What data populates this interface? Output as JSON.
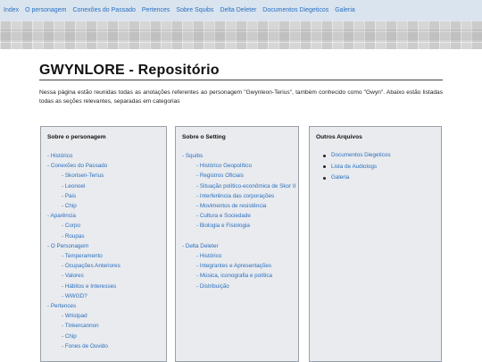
{
  "nav": [
    "Index",
    "O personagem",
    "Conexões do Passado",
    "Pertences",
    "Sobre Squibs",
    "Delta Deleter",
    "Documentos Diegeticos",
    "Galeria"
  ],
  "page": {
    "title": "GWYNLORE - Repositório",
    "intro": "Nessa página estão reunidas todas as anotações referentes ao personagem \"Gwynleon-Terius\", também conhecido como \"Gwyn\". Abaixo estão listadas todas as seções relevantes, separadas em categorias"
  },
  "panels": {
    "personagem": {
      "title": "Sobre o personagem",
      "items": [
        {
          "label": "Histórico",
          "level": 1
        },
        {
          "label": "Conexões do Passado",
          "level": 1
        },
        {
          "label": "Skorisen-Terius",
          "level": 2
        },
        {
          "label": "Leonoel",
          "level": 2
        },
        {
          "label": "Pais",
          "level": 2
        },
        {
          "label": "Chip",
          "level": 2
        },
        {
          "label": "Aparência",
          "level": 1
        },
        {
          "label": "Corpo",
          "level": 2
        },
        {
          "label": "Roupas",
          "level": 2
        },
        {
          "label": "O Personagem",
          "level": 1
        },
        {
          "label": "Temperamento",
          "level": 2
        },
        {
          "label": "Ocupações Anteriores",
          "level": 2
        },
        {
          "label": "Valores",
          "level": 2
        },
        {
          "label": "Hábitos e Interesses",
          "level": 2
        },
        {
          "label": "WWGD?",
          "level": 2
        },
        {
          "label": "Pertences",
          "level": 1
        },
        {
          "label": "Wristpad",
          "level": 2
        },
        {
          "label": "Tinkercannon",
          "level": 2
        },
        {
          "label": "Chip",
          "level": 2
        },
        {
          "label": "Fones de Ouvido",
          "level": 2
        }
      ]
    },
    "setting": {
      "title": "Sobre o Setting",
      "items": [
        {
          "label": "Squibs",
          "level": 1
        },
        {
          "label": "Histórico Geopolítico",
          "level": 2
        },
        {
          "label": "Registros Oficiais",
          "level": 2
        },
        {
          "label": "Situação político-econômica de Skor II",
          "level": 2
        },
        {
          "label": "Interferência das corporações",
          "level": 2
        },
        {
          "label": "Movimentos de resistência",
          "level": 2
        },
        {
          "label": "Cultura e Sociedade",
          "level": 2
        },
        {
          "label": "Biologia e Fisiologia",
          "level": 2
        },
        {
          "label": "",
          "level": 0
        },
        {
          "label": "Delta Deleter",
          "level": 1
        },
        {
          "label": "Histórico",
          "level": 2
        },
        {
          "label": "Integrantes e Apresentações",
          "level": 2
        },
        {
          "label": "Música, iconografia e política",
          "level": 2
        },
        {
          "label": "Distribuição",
          "level": 2
        }
      ]
    },
    "outros": {
      "title": "Outros Arquivos",
      "items": [
        "Documentos Diegeticos",
        "Lista de Audiologs",
        "Galeria"
      ]
    }
  }
}
